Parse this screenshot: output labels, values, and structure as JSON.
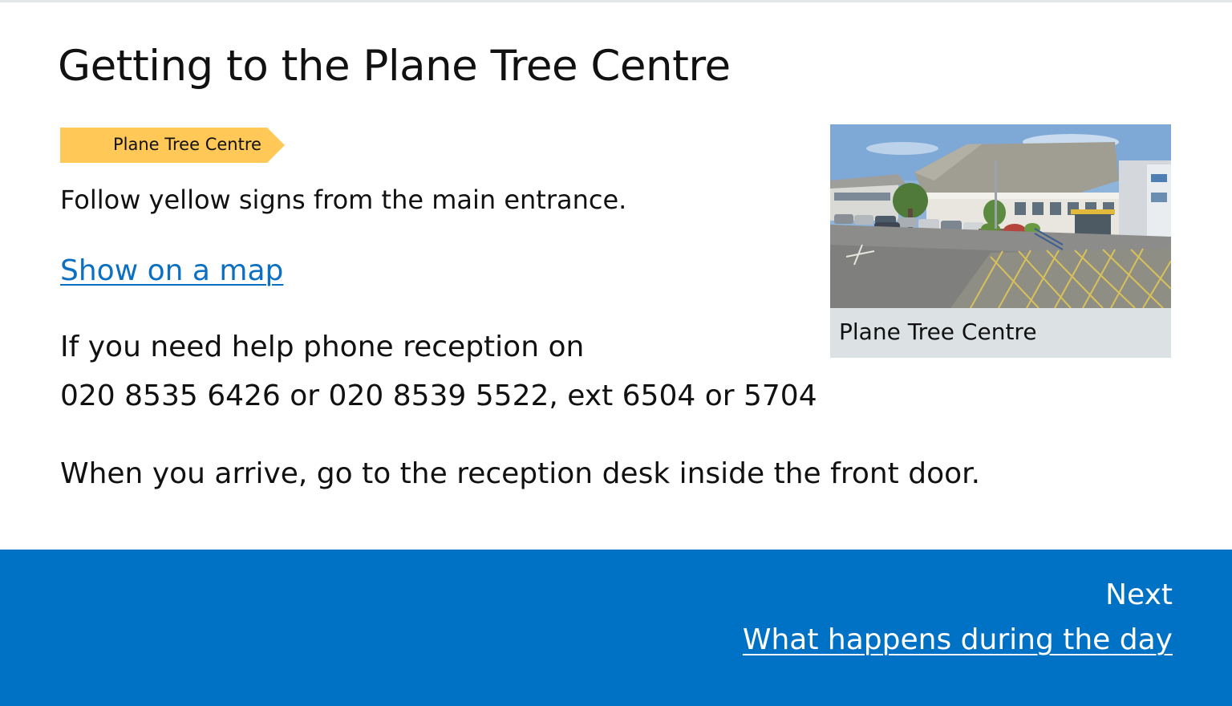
{
  "page": {
    "title": "Getting to the Plane Tree Centre"
  },
  "directions": {
    "sign_label": "Plane Tree Centre",
    "sign_color": "#ffc857",
    "follow_text": "Follow yellow signs from the main entrance.",
    "map_link_label": "Show on a map",
    "help_line_1": "If you need help phone reception on",
    "help_line_2": "020 8535 6426 or 020 8539 5522, ext 6504 or 5704",
    "arrive_text": "When you arrive, go to the reception desk inside the front door."
  },
  "photo": {
    "caption": "Plane Tree Centre"
  },
  "footer": {
    "next_label": "Next",
    "next_link_label": "What happens during the day",
    "background_color": "#0072c6"
  },
  "colors": {
    "link": "#0b6fc2",
    "text": "#111111"
  }
}
